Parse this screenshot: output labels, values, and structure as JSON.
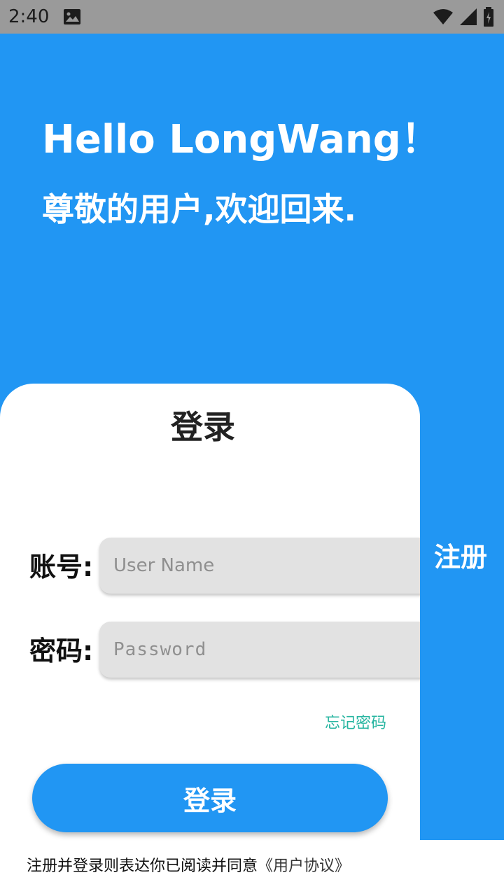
{
  "status_bar": {
    "time": "2:40",
    "icons": [
      "image-icon",
      "wifi-icon",
      "signal-icon",
      "battery-icon"
    ]
  },
  "header": {
    "title": "Hello LongWang！",
    "subtitle": "尊敬的用户,欢迎回来."
  },
  "login_card": {
    "title": "登录",
    "username_label": "账号:",
    "username_placeholder": "User Name",
    "password_label": "密码:",
    "password_placeholder": "Password",
    "forgot_password": "忘记密码",
    "login_button": "登录"
  },
  "register_tab": {
    "label": "注册"
  },
  "footer": {
    "agreement_text": "注册并登录则表达你已阅读并同意",
    "agreement_link": "《用户协议》"
  },
  "colors": {
    "primary": "#2196f3",
    "accent_teal": "#26b5a0",
    "status_bar": "#9a9a9a",
    "input_bg": "#e2e2e2"
  }
}
